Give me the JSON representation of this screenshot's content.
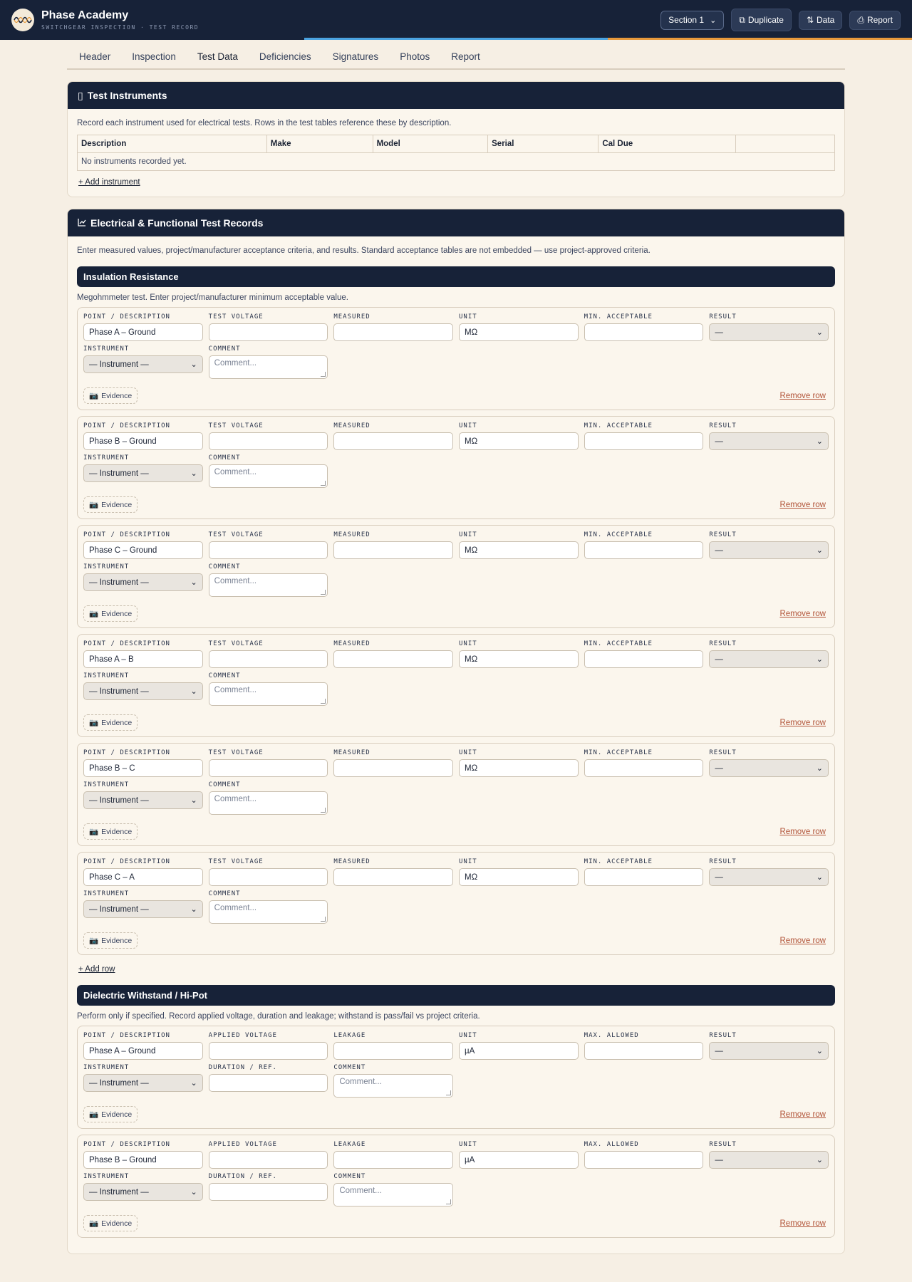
{
  "app": {
    "title": "Phase Academy",
    "subtitle": "SWITCHGEAR INSPECTION · TEST RECORD",
    "section_select": "Section 1",
    "buttons": {
      "duplicate": "Duplicate",
      "data": "Data",
      "report": "Report"
    },
    "icons": {
      "duplicate": "copy-icon",
      "data": "swap-icon",
      "report": "printer-icon",
      "logo": "waveform-logo"
    }
  },
  "tabs": [
    "Header",
    "Inspection",
    "Test Data",
    "Deficiencies",
    "Signatures",
    "Photos",
    "Report"
  ],
  "active_tab": "Test Data",
  "instruments": {
    "title": "Test Instruments",
    "help": "Record each instrument used for electrical tests. Rows in the test tables reference these by description.",
    "columns": [
      "Description",
      "Make",
      "Model",
      "Serial",
      "Cal Due",
      ""
    ],
    "empty": "No instruments recorded yet.",
    "add": "+ Add instrument"
  },
  "tests": {
    "title": "Electrical & Functional Test Records",
    "help": "Enter measured values, project/manufacturer acceptance criteria, and results. Standard acceptance tables are not embedded — use project-approved criteria.",
    "insulation": {
      "title": "Insulation Resistance",
      "help": "Megohmmeter test. Enter project/manufacturer minimum acceptable value.",
      "labels": [
        "POINT / DESCRIPTION",
        "TEST VOLTAGE",
        "MEASURED",
        "UNIT",
        "MIN. ACCEPTABLE",
        "RESULT",
        "INSTRUMENT",
        "COMMENT"
      ],
      "rows": [
        {
          "point": "Phase A – Ground",
          "unit": "MΩ",
          "result": "—",
          "instrument": "— Instrument —",
          "comment_ph": "Comment..."
        },
        {
          "point": "Phase B – Ground",
          "unit": "MΩ",
          "result": "—",
          "instrument": "— Instrument —",
          "comment_ph": "Comment..."
        },
        {
          "point": "Phase C – Ground",
          "unit": "MΩ",
          "result": "—",
          "instrument": "— Instrument —",
          "comment_ph": "Comment..."
        },
        {
          "point": "Phase A – B",
          "unit": "MΩ",
          "result": "—",
          "instrument": "— Instrument —",
          "comment_ph": "Comment..."
        },
        {
          "point": "Phase B – C",
          "unit": "MΩ",
          "result": "—",
          "instrument": "— Instrument —",
          "comment_ph": "Comment..."
        },
        {
          "point": "Phase C – A",
          "unit": "MΩ",
          "result": "—",
          "instrument": "— Instrument —",
          "comment_ph": "Comment..."
        }
      ],
      "evidence": "Evidence",
      "remove": "Remove row",
      "add": "+ Add row"
    },
    "hipot": {
      "title": "Dielectric Withstand / Hi-Pot",
      "help": "Perform only if specified. Record applied voltage, duration and leakage; withstand is pass/fail vs project criteria.",
      "labels": [
        "POINT / DESCRIPTION",
        "APPLIED VOLTAGE",
        "LEAKAGE",
        "UNIT",
        "MAX. ALLOWED",
        "RESULT",
        "INSTRUMENT",
        "DURATION / REF.",
        "COMMENT"
      ],
      "rows": [
        {
          "point": "Phase A – Ground",
          "unit": "µA",
          "result": "—",
          "instrument": "— Instrument —",
          "comment_ph": "Comment..."
        },
        {
          "point": "Phase B – Ground",
          "unit": "µA",
          "result": "—",
          "instrument": "— Instrument —",
          "comment_ph": "Comment..."
        }
      ],
      "evidence": "Evidence",
      "remove": "Remove row"
    }
  }
}
